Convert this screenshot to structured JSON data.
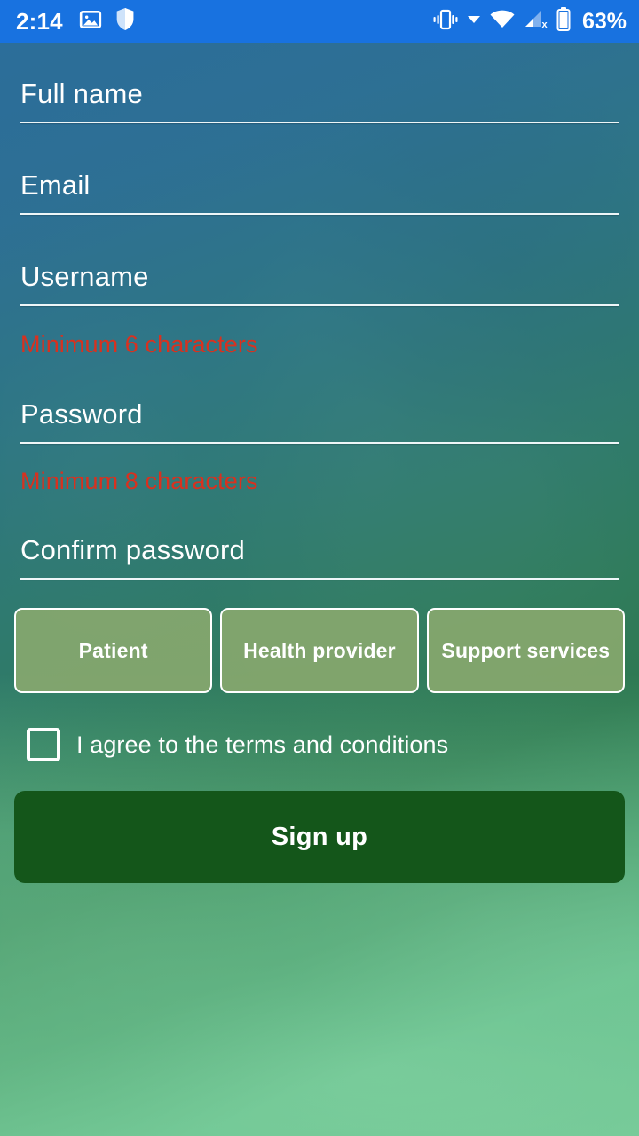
{
  "status_bar": {
    "time": "2:14",
    "battery_percent": "63%",
    "background_color": "#1872e0",
    "left_icons": [
      "image-icon",
      "shield-icon"
    ],
    "right_icons": [
      "vibrate-icon",
      "chevron-down-icon",
      "wifi-icon",
      "signal-off-icon",
      "battery-icon"
    ]
  },
  "form": {
    "fields": [
      {
        "label": "Full name",
        "value": "",
        "type": "text",
        "error": ""
      },
      {
        "label": "Email",
        "value": "",
        "type": "email",
        "error": ""
      },
      {
        "label": "Username",
        "value": "",
        "type": "text",
        "error": "Minimum 6 characters"
      },
      {
        "label": "Password",
        "value": "",
        "type": "password",
        "error": "Minimum 8 characters"
      },
      {
        "label": "Confirm password",
        "value": "",
        "type": "password",
        "error": ""
      }
    ],
    "roles": [
      {
        "label": "Patient",
        "selected": false
      },
      {
        "label": "Health provider",
        "selected": false
      },
      {
        "label": "Support services",
        "selected": false
      }
    ],
    "terms": {
      "label": "I agree to the terms and conditions",
      "checked": false
    },
    "submit": {
      "label": "Sign up",
      "color": "#14561a"
    }
  },
  "colors": {
    "accent_blue": "#1872e0",
    "error_red": "#d8311f",
    "role_green": "#8baa6e",
    "signup_green": "#14561a",
    "field_text": "#ffffff"
  }
}
